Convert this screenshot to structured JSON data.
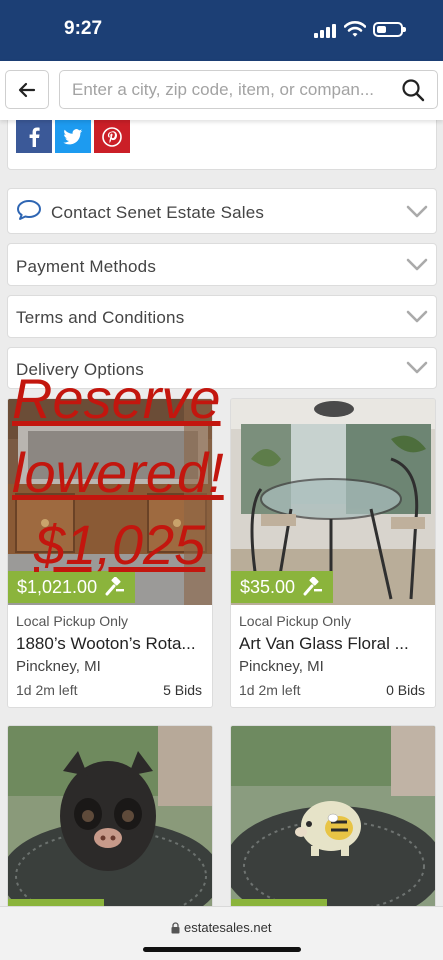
{
  "status": {
    "time": "9:27",
    "battery_level": 0.4
  },
  "search": {
    "placeholder": "Enter a city, zip code, item, or compan..."
  },
  "sections": [
    {
      "label": "Contact Senet Estate Sales"
    },
    {
      "label": "Payment Methods"
    },
    {
      "label": "Terms and Conditions"
    },
    {
      "label": "Delivery Options"
    }
  ],
  "overlay": {
    "line1": "Reserve",
    "line2": "lowered!",
    "line3": "$1,025"
  },
  "items": [
    {
      "price": "$1,021.00",
      "pickup": "Local Pickup Only",
      "title": "1880’s Wooton’s Rota...",
      "location": "Pinckney, MI",
      "time_left": "1d 2m left",
      "bids": "5 Bids"
    },
    {
      "price": "$35.00",
      "pickup": "Local Pickup Only",
      "title": "Art Van Glass Floral ...",
      "location": "Pinckney, MI",
      "time_left": "1d 2m left",
      "bids": "0 Bids"
    }
  ],
  "url": "estatesales.net",
  "colors": {
    "header": "#1c3f75",
    "price_badge": "#8bb43c",
    "overlay_text": "#c3160e",
    "facebook": "#3b5998",
    "twitter": "#1d9bf0",
    "pinterest": "#cb1f27"
  }
}
